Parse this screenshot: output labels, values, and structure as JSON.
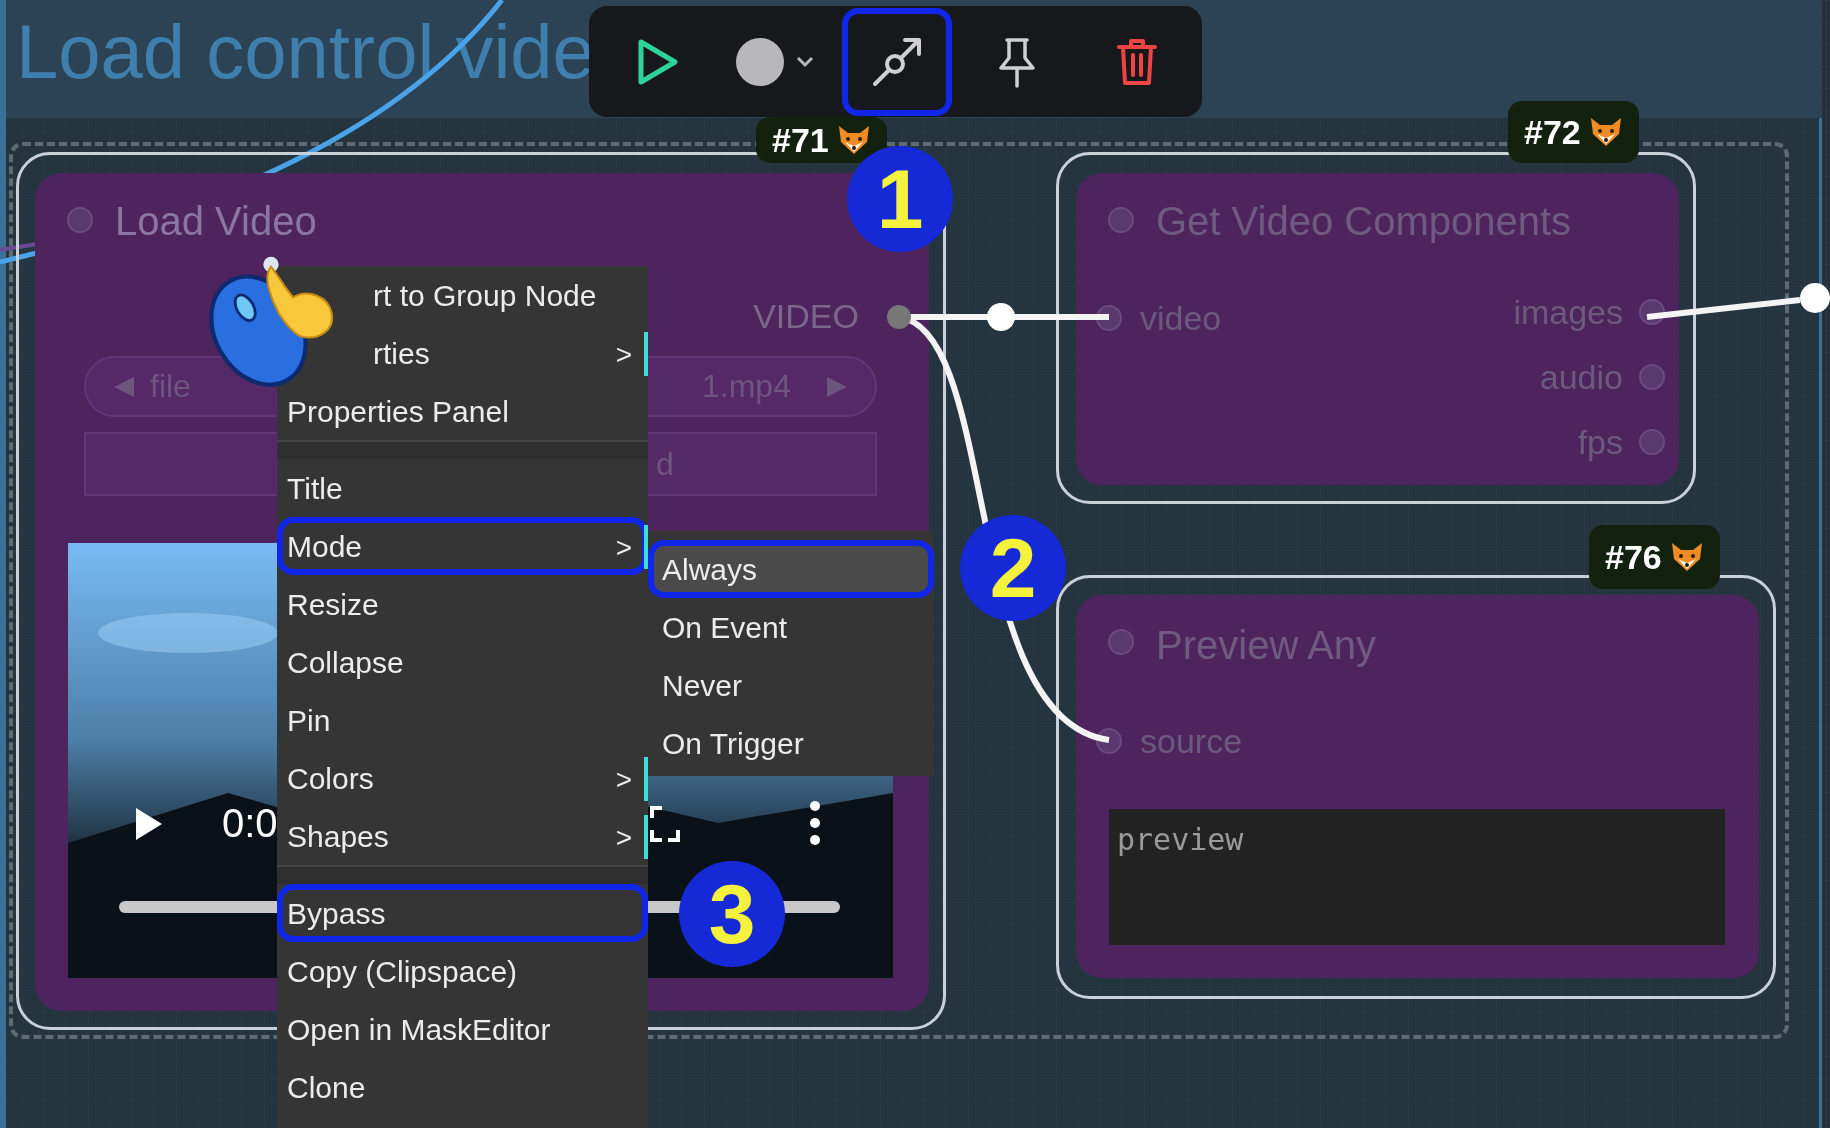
{
  "group": {
    "title": "Load control vide"
  },
  "toolbar": {
    "buttons": [
      {
        "kind": "run",
        "highlighted": false
      },
      {
        "kind": "color",
        "highlighted": false
      },
      {
        "kind": "link",
        "highlighted": true
      },
      {
        "kind": "pin",
        "highlighted": false
      },
      {
        "kind": "delete",
        "highlighted": false
      }
    ]
  },
  "nodes": [
    {
      "badge": "#71",
      "title": "Load Video",
      "outputs": [
        "VIDEO"
      ],
      "widgets": [
        {
          "kind": "combo",
          "label": "file",
          "value": "1.mp4"
        },
        {
          "kind": "upload",
          "label": "d"
        }
      ],
      "video": {
        "time": "0:0"
      }
    },
    {
      "badge": "#72",
      "title": "Get Video Components",
      "inputs": [
        "video"
      ],
      "outputs": [
        "images",
        "audio",
        "fps"
      ]
    },
    {
      "badge": "#76",
      "title": "Preview Any",
      "inputs": [
        "source"
      ],
      "preview": {
        "placeholder": "preview"
      }
    }
  ],
  "context_menu": {
    "sections": [
      [
        {
          "label": "rt to Group Node",
          "highlighted": false,
          "kind": "covered"
        },
        {
          "label": "rties",
          "arrow": ">",
          "highlighted": false,
          "kind": "covered"
        },
        {
          "label": "Properties Panel",
          "highlighted": false,
          "kind": "plain"
        }
      ],
      [
        {
          "label": "Title",
          "highlighted": false,
          "kind": "plain"
        },
        {
          "label": "Mode",
          "arrow": ">",
          "highlighted": true,
          "kind": "plain"
        },
        {
          "label": "Resize",
          "highlighted": false,
          "kind": "plain"
        },
        {
          "label": "Collapse",
          "highlighted": false,
          "kind": "plain"
        },
        {
          "label": "Pin",
          "highlighted": false,
          "kind": "plain"
        },
        {
          "label": "Colors",
          "arrow": ">",
          "highlighted": false,
          "kind": "plain"
        },
        {
          "label": "Shapes",
          "arrow": ">",
          "highlighted": false,
          "kind": "plain"
        }
      ],
      [
        {
          "label": "Bypass",
          "highlighted": true,
          "kind": "plain"
        },
        {
          "label": "Copy (Clipspace)",
          "highlighted": false,
          "kind": "plain"
        },
        {
          "label": "Open in MaskEditor",
          "highlighted": false,
          "kind": "plain"
        },
        {
          "label": "Clone",
          "highlighted": false,
          "kind": "plain"
        }
      ]
    ],
    "submenu": {
      "items": [
        {
          "label": "Always",
          "selected": true,
          "highlighted": true
        },
        {
          "label": "On Event",
          "selected": false,
          "highlighted": false
        },
        {
          "label": "Never",
          "selected": false,
          "highlighted": false
        },
        {
          "label": "On Trigger",
          "selected": false,
          "highlighted": false
        }
      ]
    }
  },
  "annotations": [
    {
      "label": "1"
    },
    {
      "label": "2"
    },
    {
      "label": "3"
    }
  ]
}
